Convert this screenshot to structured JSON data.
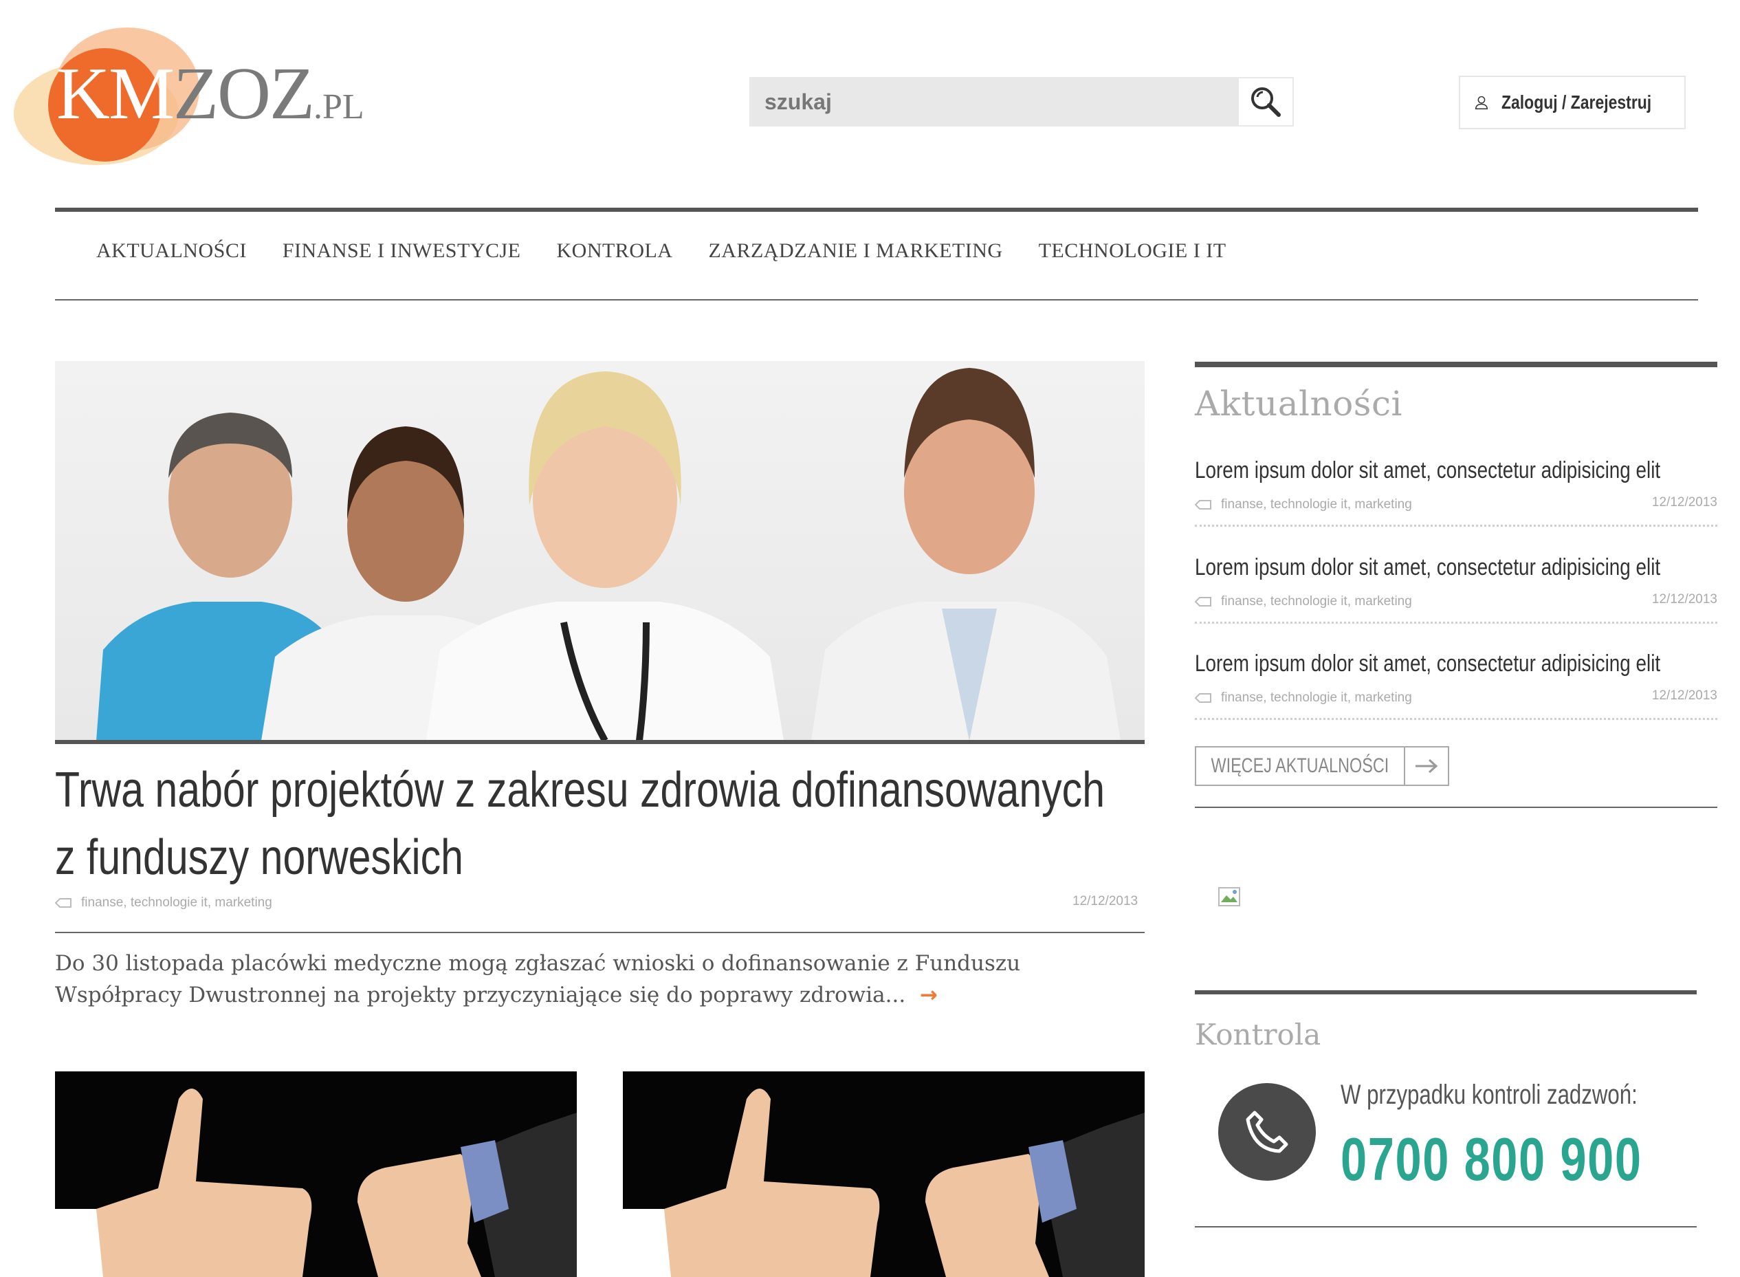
{
  "logo": {
    "brand_a": "KM",
    "brand_b": "ZOZ",
    "brand_tld": ".PL"
  },
  "search": {
    "placeholder": "szukaj"
  },
  "account": {
    "login_label": "Zaloguj / Zarejestruj"
  },
  "nav": {
    "items": [
      {
        "label": "AKTUALNOŚCI"
      },
      {
        "label": "FINANSE I INWESTYCJE"
      },
      {
        "label": "KONTROLA"
      },
      {
        "label": "ZARZĄDZANIE I MARKETING"
      },
      {
        "label": "TECHNOLOGIE I IT"
      }
    ]
  },
  "featured": {
    "title": "Trwa nabór projektów z zakresu zdrowia dofinansowanych z funduszy norweskich",
    "tags": [
      "finanse",
      "technologie it",
      "marketing"
    ],
    "date": "12/12/2013",
    "excerpt": "Do 30 listopada placówki medyczne mogą zgłaszać wnioski o dofinansowanie z Funduszu Współpracy Dwustronnej na projekty przyczyniające się do poprawy zdrowia..."
  },
  "sidebar": {
    "news_title": "Aktualności",
    "news": [
      {
        "title": "Lorem ipsum dolor sit amet, consectetur adipisicing elit",
        "tags": [
          "finanse",
          "technologie it",
          "marketing"
        ],
        "date": "12/12/2013"
      },
      {
        "title": "Lorem ipsum dolor sit amet, consectetur adipisicing elit",
        "tags": [
          "finanse",
          "technologie it",
          "marketing"
        ],
        "date": "12/12/2013"
      },
      {
        "title": "Lorem ipsum dolor sit amet, consectetur adipisicing elit",
        "tags": [
          "finanse",
          "technologie it",
          "marketing"
        ],
        "date": "12/12/2013"
      }
    ],
    "more_label": "WIĘCEJ AKTUALNOŚCI",
    "control_title": "Kontrola",
    "call_text": "W przypadku kontroli zadzwoń:",
    "phone": "0700 800 900"
  },
  "colors": {
    "accent_orange": "#ee6b2b",
    "phone_teal": "#2aa58f",
    "rule_gray": "#555555"
  }
}
